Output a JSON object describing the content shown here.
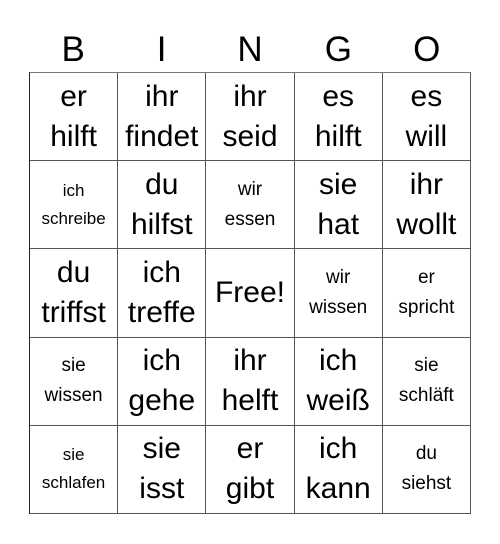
{
  "header": [
    "B",
    "I",
    "N",
    "G",
    "O"
  ],
  "cells": [
    {
      "text": "er\nhilft",
      "size": "big"
    },
    {
      "text": "ihr\nfindet",
      "size": "big"
    },
    {
      "text": "ihr\nseid",
      "size": "big"
    },
    {
      "text": "es\nhilft",
      "size": "big"
    },
    {
      "text": "es\nwill",
      "size": "big"
    },
    {
      "text": "ich\nschreibe",
      "size": "tiny"
    },
    {
      "text": "du\nhilfst",
      "size": "big"
    },
    {
      "text": "wir\nessen",
      "size": "small"
    },
    {
      "text": "sie\nhat",
      "size": "big"
    },
    {
      "text": "ihr\nwollt",
      "size": "big"
    },
    {
      "text": "du\ntriffst",
      "size": "big"
    },
    {
      "text": "ich\ntreffe",
      "size": "big"
    },
    {
      "text": "Free!",
      "size": "big"
    },
    {
      "text": "wir\nwissen",
      "size": "small"
    },
    {
      "text": "er\nspricht",
      "size": "small"
    },
    {
      "text": "sie\nwissen",
      "size": "small"
    },
    {
      "text": "ich\ngehe",
      "size": "big"
    },
    {
      "text": "ihr\nhelft",
      "size": "big"
    },
    {
      "text": "ich\nweiß",
      "size": "big"
    },
    {
      "text": "sie\nschläft",
      "size": "small"
    },
    {
      "text": "sie\nschlafen",
      "size": "tiny"
    },
    {
      "text": "sie\nisst",
      "size": "big"
    },
    {
      "text": "er\ngibt",
      "size": "big"
    },
    {
      "text": "ich\nkann",
      "size": "big"
    },
    {
      "text": "du\nsiehst",
      "size": "small"
    }
  ]
}
